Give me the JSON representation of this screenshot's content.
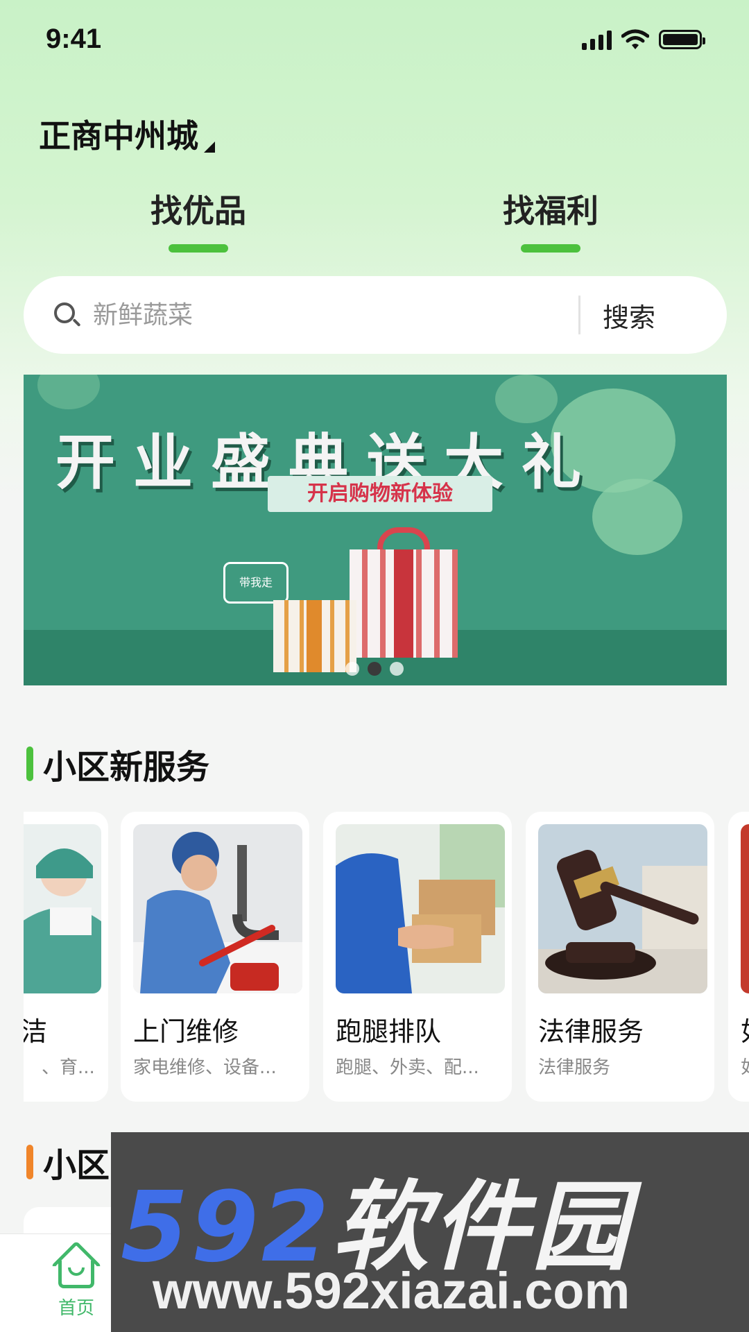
{
  "status_bar": {
    "time": "9:41"
  },
  "header": {
    "location": "正商中州城"
  },
  "tabs": [
    {
      "label": "找优品",
      "active": true
    },
    {
      "label": "找福利",
      "active": false
    }
  ],
  "search": {
    "placeholder": "新鲜蔬菜",
    "button_label": "搜索"
  },
  "banner": {
    "title": "开业盛典送大礼",
    "subtitle": "开启购物新体验",
    "speech_bubble": "带我走",
    "slides_total": 3,
    "active_slide": 2
  },
  "services_section": {
    "title": "小区新服务",
    "accent_color": "#4cc13d",
    "cards": [
      {
        "name": "洁",
        "desc": "、育...",
        "icon": "cleaning-photo"
      },
      {
        "name": "上门维修",
        "desc": "家电维修、设备...",
        "icon": "repair-photo"
      },
      {
        "name": "跑腿排队",
        "desc": "跑腿、外卖、配...",
        "icon": "delivery-photo"
      },
      {
        "name": "法律服务",
        "desc": "法律服务",
        "icon": "legal-photo"
      },
      {
        "name": "如",
        "desc": "如",
        "icon": "partial-photo"
      }
    ]
  },
  "second_section": {
    "title": "小区",
    "accent_color": "#f0852a"
  },
  "bottom_nav": {
    "home_label": "首页",
    "accent_color": "#41b86a"
  },
  "watermark": {
    "title_num": "592",
    "title_cn": "软件园",
    "url": "www.592xiazai.com"
  }
}
